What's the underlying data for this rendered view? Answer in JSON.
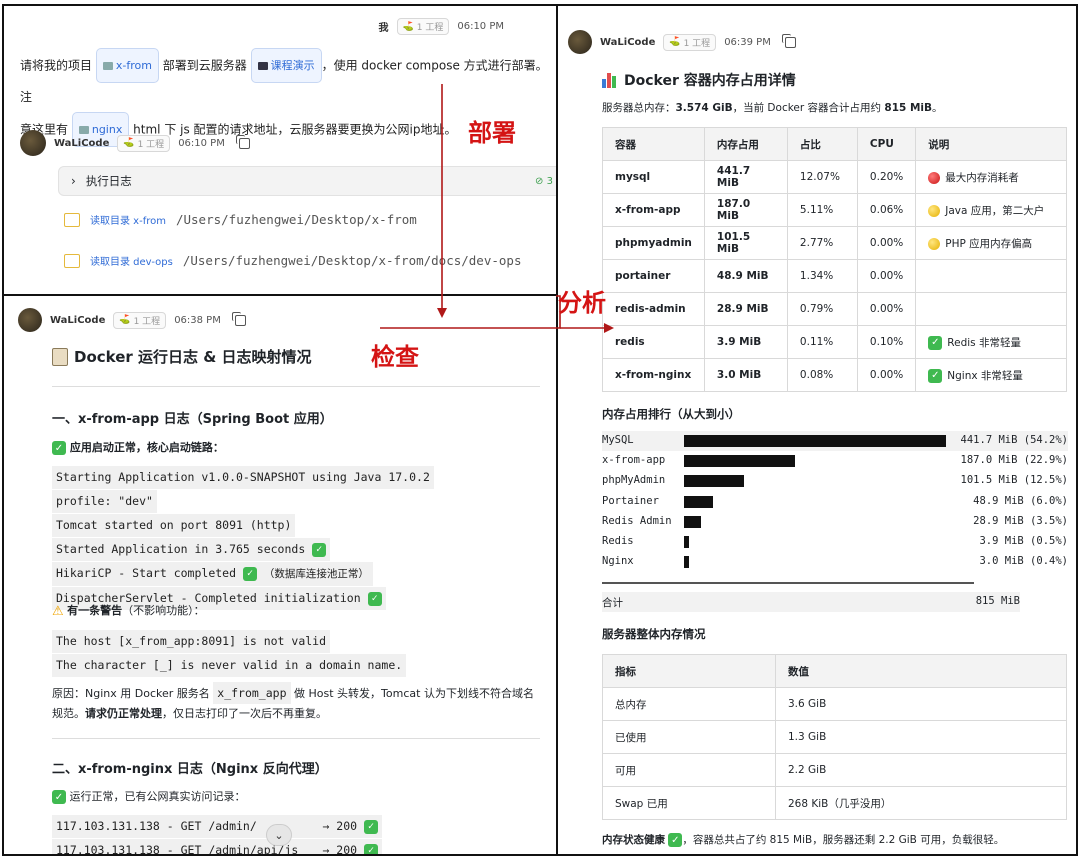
{
  "p1": {
    "user_name": "我",
    "tag": "1 工程",
    "user_time": "06:10 PM",
    "msg_a": "请将我的项目",
    "chip_xfrom": "x-from",
    "msg_b": "部署到云服务器",
    "chip_course": "课程演示",
    "msg_c": "，使用 docker compose 方式进行部署。注",
    "msg_d": "意这里有",
    "chip_nginx": "nginx",
    "msg_e": "html 下 js 配置的请求地址，云服务器要更换为公网ip地址。",
    "bot_name": "WaLiCode",
    "bot_time": "06:10 PM",
    "log_label": "执行日志",
    "log_status": "3",
    "read1_label": "读取目录 x-from",
    "read1_path": "/Users/fuzhengwei/Desktop/x-from",
    "read2_label": "读取目录 dev-ops",
    "read2_path": "/Users/fuzhengwei/Desktop/x-from/docs/dev-ops"
  },
  "annot": {
    "deploy": "部署",
    "check": "检查",
    "analyze": "分析",
    "arrow_color": "#b01818"
  },
  "p2": {
    "bot_name": "WaLiCode",
    "tag": "1 工程",
    "time": "06:38 PM",
    "title": "Docker 运行日志 & 日志映射情况",
    "sec1": "一、x-from-app 日志（Spring Boot 应用）",
    "ok1": "应用启动正常，核心启动链路：",
    "code1": [
      "Starting Application v1.0.0-SNAPSHOT using Java 17.0.2",
      "profile: \"dev\"",
      "Tomcat started on port 8091 (http)",
      "Started Application in 3.765 seconds",
      "HikariCP - Start completed",
      "DispatcherServlet - Completed initialization"
    ],
    "code1_note": "（数据库连接池正常）",
    "warn": "有一条警告",
    "warn_tail": "（不影响功能）：",
    "code2": [
      "The host [x_from_app:8091] is not valid",
      "The character [_] is never valid in a domain name."
    ],
    "reason_a": "原因：Nginx 用 Docker 服务名",
    "reason_code": "x_from_app",
    "reason_b": "做 Host 头转发，Tomcat 认为下划线不符合域名",
    "reason_c": "规范。",
    "reason_bold": "请求仍正常处理",
    "reason_d": "，仅日志打印了一次后不再重复。",
    "sec2": "二、x-from-nginx 日志（Nginx 反向代理）",
    "ok2": "运行正常，已有公网真实访问记录：",
    "code3": [
      "117.103.131.138 - GET /admin/",
      "117.103.131.138 - GET /admin/api/js"
    ],
    "code3_status": "→ 200"
  },
  "p3": {
    "bot_name": "WaLiCode",
    "tag": "1 工程",
    "time": "06:39 PM",
    "title": "Docker 容器内存占用详情",
    "summary_a": "服务器总内存：",
    "summary_total": "3.574 GiB",
    "summary_b": "，当前 Docker 容器合计占用约",
    "summary_used": "815 MiB",
    "summary_c": "。",
    "table_headers": [
      "容器",
      "内存占用",
      "占比",
      "CPU",
      "说明"
    ],
    "table_rows": [
      {
        "name": "mysql",
        "mem": "441.7 MiB",
        "pct": "12.07%",
        "cpu": "0.20%",
        "icon": "red-circle-icon",
        "note": "最大内存消耗者"
      },
      {
        "name": "x-from-app",
        "mem": "187.0 MiB",
        "pct": "5.11%",
        "cpu": "0.06%",
        "icon": "yellow-circle-icon",
        "note": "Java 应用，第二大户"
      },
      {
        "name": "phpmyadmin",
        "mem": "101.5 MiB",
        "pct": "2.77%",
        "cpu": "0.00%",
        "icon": "yellow-circle-icon",
        "note": "PHP 应用内存偏高"
      },
      {
        "name": "portainer",
        "mem": "48.9 MiB",
        "pct": "1.34%",
        "cpu": "0.00%",
        "icon": "",
        "note": ""
      },
      {
        "name": "redis-admin",
        "mem": "28.9 MiB",
        "pct": "0.79%",
        "cpu": "0.00%",
        "icon": "",
        "note": ""
      },
      {
        "name": "redis",
        "mem": "3.9 MiB",
        "pct": "0.11%",
        "cpu": "0.10%",
        "icon": "check-icon",
        "note": "Redis 非常轻量"
      },
      {
        "name": "x-from-nginx",
        "mem": "3.0 MiB",
        "pct": "0.08%",
        "cpu": "0.00%",
        "icon": "check-icon",
        "note": "Nginx 非常轻量"
      }
    ],
    "rank_title": "内存占用排行（从大到小）",
    "total_label": "合计",
    "total_value": "815 MiB",
    "server_title": "服务器整体内存情况",
    "server_headers": [
      "指标",
      "数值"
    ],
    "server_rows": [
      [
        "总内存",
        "3.6 GiB"
      ],
      [
        "已使用",
        "1.3 GiB"
      ],
      [
        "可用",
        "2.2 GiB"
      ],
      [
        "Swap 已用",
        "268 KiB（几乎没用）"
      ]
    ],
    "health_bold": "内存状态健康",
    "health_text": "，容器总共占了约 815 MiB，服务器还剩 2.2 GiB 可用，负载很轻。"
  },
  "chart_data": {
    "type": "bar",
    "title": "内存占用排行（从大到小）",
    "categories": [
      "MySQL",
      "x-from-app",
      "phpMyAdmin",
      "Portainer",
      "Redis Admin",
      "Redis",
      "Nginx"
    ],
    "values": [
      441.7,
      187.0,
      101.5,
      48.9,
      28.9,
      3.9,
      3.0
    ],
    "value_labels": [
      "441.7 MiB (54.2%)",
      "187.0 MiB (22.9%)",
      "101.5 MiB (12.5%)",
      "48.9 MiB (6.0%)",
      "28.9 MiB (3.5%)",
      "3.9 MiB (0.5%)",
      "3.0 MiB (0.4%)"
    ],
    "ylabel": "",
    "xlabel": "",
    "legend": "none",
    "grid": false
  }
}
